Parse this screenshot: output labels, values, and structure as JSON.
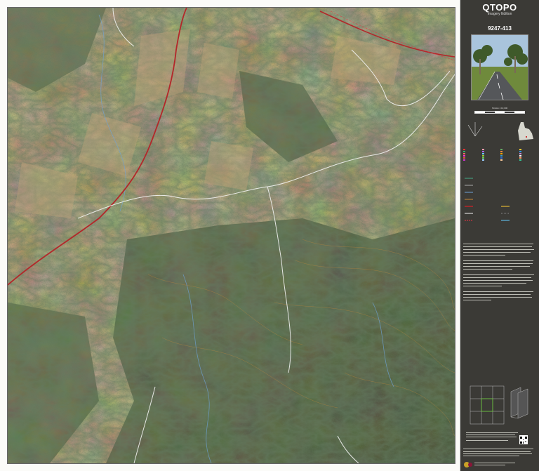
{
  "legend": {
    "title": "QTOPO",
    "subtitle": "Imagery Edition",
    "sheet_number": "9247-413",
    "scale": "SCALE 1:10,000"
  },
  "colors": {
    "legend_background": "#3b3a36",
    "map_vegetation_dark": "#2f4a2c",
    "map_cleared_land": "#9b845f",
    "road_primary": "#b3272a",
    "road_minor": "#f4f4f4",
    "contour": "#c98a3a",
    "watercourse": "#6fa3d8"
  },
  "icons": [
    "cover-photo-road",
    "queensland-locator-map",
    "qr-code-icon",
    "government-logo-icon"
  ]
}
